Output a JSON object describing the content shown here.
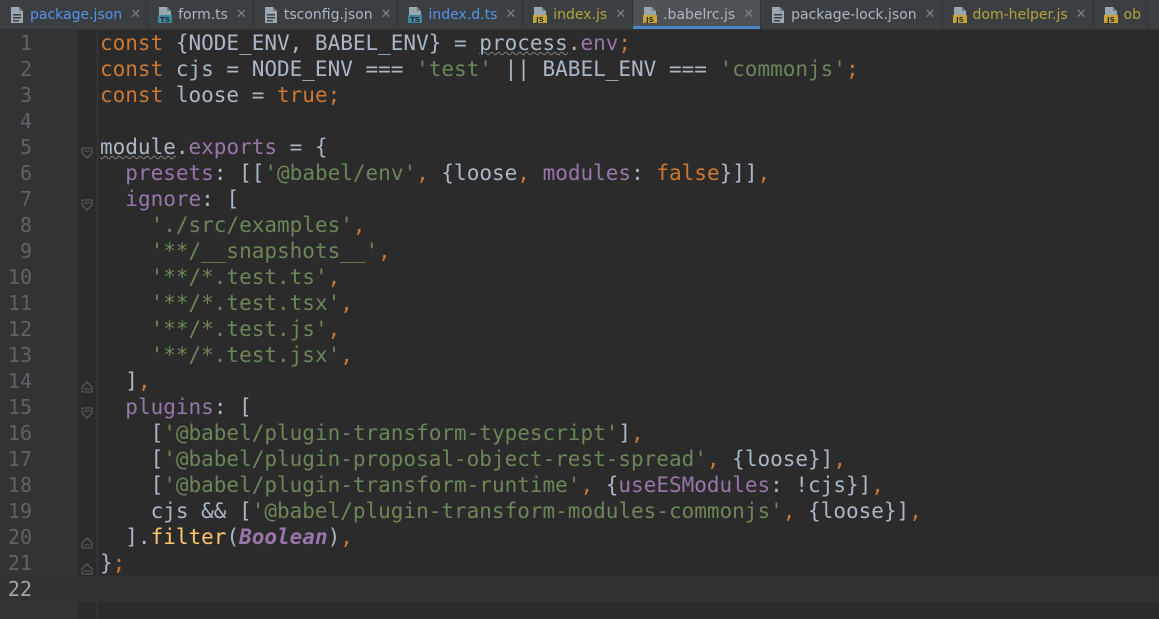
{
  "tabs": [
    {
      "label": "package.json",
      "color": "#5394ec",
      "icon": "json-file-icon",
      "active": false
    },
    {
      "label": "form.ts",
      "color": "#a9b7c6",
      "icon": "typescript-file-icon",
      "active": false
    },
    {
      "label": "tsconfig.json",
      "color": "#a9b7c6",
      "icon": "json-file-icon",
      "active": false
    },
    {
      "label": "index.d.ts",
      "color": "#5394ec",
      "icon": "typescript-file-icon",
      "active": false
    },
    {
      "label": "index.js",
      "color": "#b5a33a",
      "icon": "javascript-file-icon",
      "active": false
    },
    {
      "label": ".babelrc.js",
      "color": "#a9b7c6",
      "icon": "javascript-file-icon",
      "active": true
    },
    {
      "label": "package-lock.json",
      "color": "#a9b7c6",
      "icon": "json-file-icon",
      "active": false
    },
    {
      "label": "dom-helper.js",
      "color": "#b5a33a",
      "icon": "javascript-file-icon",
      "active": false
    },
    {
      "label": "ob",
      "color": "#b5a33a",
      "icon": "javascript-file-icon",
      "active": false
    }
  ],
  "close_glyph": "✕",
  "icon_text": {
    "ts": "TS",
    "js": "JS"
  },
  "colors": {
    "background": "#2b2b2b",
    "gutter": "#313335",
    "keyword": "#cc7832",
    "string": "#6a8759",
    "property": "#9876aa",
    "function": "#ffc66d",
    "text": "#a9b7c6",
    "line_number": "#606366",
    "active_tab_underline": "#4a88c7"
  },
  "current_line": 22,
  "lines": [
    {
      "n": "1",
      "tokens": [
        [
          "kw",
          "const "
        ],
        [
          "plain",
          "{NODE_ENV, BABEL_ENV} = "
        ],
        [
          "plain warn",
          "process"
        ],
        [
          "plain",
          "."
        ],
        [
          "prop",
          "env"
        ],
        [
          "kw",
          ";"
        ]
      ]
    },
    {
      "n": "2",
      "tokens": [
        [
          "kw",
          "const "
        ],
        [
          "plain",
          "cjs = NODE_ENV === "
        ],
        [
          "str",
          "'test'"
        ],
        [
          "plain",
          " || BABEL_ENV === "
        ],
        [
          "str",
          "'commonjs'"
        ],
        [
          "kw",
          ";"
        ]
      ]
    },
    {
      "n": "3",
      "tokens": [
        [
          "kw",
          "const "
        ],
        [
          "plain",
          "loose = "
        ],
        [
          "kw",
          "true;"
        ]
      ]
    },
    {
      "n": "4",
      "tokens": []
    },
    {
      "n": "5",
      "fold": "open",
      "tokens": [
        [
          "plain warn",
          "module"
        ],
        [
          "plain",
          "."
        ],
        [
          "prop",
          "exports"
        ],
        [
          "plain",
          " = {"
        ]
      ]
    },
    {
      "n": "6",
      "tokens": [
        [
          "plain",
          "  "
        ],
        [
          "prop",
          "presets"
        ],
        [
          "plain",
          ": [["
        ],
        [
          "str",
          "'@babel/env'"
        ],
        [
          "kw",
          ", "
        ],
        [
          "plain",
          "{loose"
        ],
        [
          "kw",
          ", "
        ],
        [
          "prop",
          "modules"
        ],
        [
          "plain",
          ": "
        ],
        [
          "kw",
          "false"
        ],
        [
          "plain",
          "}]]"
        ],
        [
          "kw",
          ","
        ]
      ]
    },
    {
      "n": "7",
      "fold": "open",
      "tokens": [
        [
          "plain",
          "  "
        ],
        [
          "prop",
          "ignore"
        ],
        [
          "plain",
          ": ["
        ]
      ]
    },
    {
      "n": "8",
      "tokens": [
        [
          "plain",
          "    "
        ],
        [
          "str",
          "'./src/examples'"
        ],
        [
          "kw",
          ","
        ]
      ]
    },
    {
      "n": "9",
      "tokens": [
        [
          "plain",
          "    "
        ],
        [
          "str",
          "'**/__snapshots__'"
        ],
        [
          "kw",
          ","
        ]
      ]
    },
    {
      "n": "10",
      "tokens": [
        [
          "plain",
          "    "
        ],
        [
          "str",
          "'**/*.test.ts'"
        ],
        [
          "kw",
          ","
        ]
      ]
    },
    {
      "n": "11",
      "tokens": [
        [
          "plain",
          "    "
        ],
        [
          "str",
          "'**/*.test.tsx'"
        ],
        [
          "kw",
          ","
        ]
      ]
    },
    {
      "n": "12",
      "tokens": [
        [
          "plain",
          "    "
        ],
        [
          "str",
          "'**/*.test.js'"
        ],
        [
          "kw",
          ","
        ]
      ]
    },
    {
      "n": "13",
      "tokens": [
        [
          "plain",
          "    "
        ],
        [
          "str",
          "'**/*.test.jsx'"
        ],
        [
          "kw",
          ","
        ]
      ]
    },
    {
      "n": "14",
      "fold": "close",
      "tokens": [
        [
          "plain",
          "  ]"
        ],
        [
          "kw",
          ","
        ]
      ]
    },
    {
      "n": "15",
      "fold": "open",
      "tokens": [
        [
          "plain",
          "  "
        ],
        [
          "prop",
          "plugins"
        ],
        [
          "plain",
          ": ["
        ]
      ]
    },
    {
      "n": "16",
      "tokens": [
        [
          "plain",
          "    ["
        ],
        [
          "str",
          "'@babel/plugin-transform-typescript'"
        ],
        [
          "plain",
          "]"
        ],
        [
          "kw",
          ","
        ]
      ]
    },
    {
      "n": "17",
      "tokens": [
        [
          "plain",
          "    ["
        ],
        [
          "str",
          "'@babel/plugin-proposal-object-rest-spread'"
        ],
        [
          "kw",
          ", "
        ],
        [
          "plain",
          "{loose}]"
        ],
        [
          "kw",
          ","
        ]
      ]
    },
    {
      "n": "18",
      "tokens": [
        [
          "plain",
          "    ["
        ],
        [
          "str",
          "'@babel/plugin-transform-runtime'"
        ],
        [
          "kw",
          ", "
        ],
        [
          "plain",
          "{"
        ],
        [
          "prop",
          "useESModules"
        ],
        [
          "plain",
          ": !cjs}]"
        ],
        [
          "kw",
          ","
        ]
      ]
    },
    {
      "n": "19",
      "tokens": [
        [
          "plain",
          "    cjs && ["
        ],
        [
          "str",
          "'@babel/plugin-transform-modules-commonjs'"
        ],
        [
          "kw",
          ", "
        ],
        [
          "plain",
          "{loose}]"
        ],
        [
          "kw",
          ","
        ]
      ]
    },
    {
      "n": "20",
      "fold": "close",
      "tokens": [
        [
          "plain",
          "  ]."
        ],
        [
          "fn",
          "filter"
        ],
        [
          "plain",
          "("
        ],
        [
          "cls",
          "Boolean"
        ],
        [
          "plain",
          ")"
        ],
        [
          "kw",
          ","
        ]
      ]
    },
    {
      "n": "21",
      "fold": "close",
      "tokens": [
        [
          "plain",
          "}"
        ],
        [
          "kw",
          ";"
        ]
      ]
    },
    {
      "n": "22",
      "tokens": []
    }
  ]
}
